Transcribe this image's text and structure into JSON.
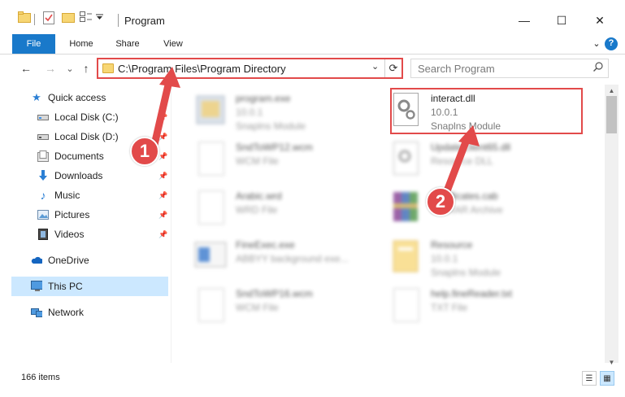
{
  "window": {
    "title": "Program",
    "minimize_glyph": "—",
    "maximize_glyph": "☐",
    "close_glyph": "✕"
  },
  "ribbon": {
    "tabs": [
      {
        "label": "File"
      },
      {
        "label": "Home"
      },
      {
        "label": "Share"
      },
      {
        "label": "View"
      }
    ],
    "help_glyph": "?"
  },
  "nav": {
    "back_glyph": "←",
    "forward_glyph": "→",
    "recent_glyph": "⌄",
    "up_glyph": "↑",
    "address": "C:\\Program Files\\Program Directory",
    "search_placeholder": "Search Program"
  },
  "sidebar": {
    "items": [
      {
        "label": "Quick access",
        "icon": "star-icon",
        "pinned": false
      },
      {
        "label": "Local Disk (C:)",
        "icon": "drive-icon",
        "pinned": true
      },
      {
        "label": "Local Disk (D:)",
        "icon": "drive-icon",
        "pinned": true
      },
      {
        "label": "Documents",
        "icon": "documents-icon",
        "pinned": true
      },
      {
        "label": "Downloads",
        "icon": "download-icon",
        "pinned": true
      },
      {
        "label": "Music",
        "icon": "music-icon",
        "pinned": true
      },
      {
        "label": "Pictures",
        "icon": "pictures-icon",
        "pinned": true
      },
      {
        "label": "Videos",
        "icon": "videos-icon",
        "pinned": true
      },
      {
        "label": "OneDrive",
        "icon": "cloud-icon",
        "pinned": false
      },
      {
        "label": "This PC",
        "icon": "computer-icon",
        "pinned": false,
        "selected": true
      },
      {
        "label": "Network",
        "icon": "network-icon",
        "pinned": false
      }
    ]
  },
  "files": [
    {
      "name": "program.exe",
      "line2": "10.0.1",
      "line3": "Snaplns Module",
      "blurred": true
    },
    {
      "name": "interact.dll",
      "line2": "10.0.1",
      "line3": "Snaplns Module",
      "blurred": false,
      "highlighted": true
    },
    {
      "name": "SndToWP12.wcm",
      "line2": "WCM File",
      "line3": "",
      "blurred": true
    },
    {
      "name": "UpdateClient65.dll",
      "line2": "Resource DLL",
      "line3": "",
      "blurred": true
    },
    {
      "name": "Arabic.wrd",
      "line2": "WRD File",
      "line3": "",
      "blurred": true
    },
    {
      "name": "Certificates.cab",
      "line2": "WinRAR Archive",
      "line3": "",
      "blurred": true
    },
    {
      "name": "FineExec.exe",
      "line2": "ABBYY background exe...",
      "line3": "",
      "blurred": true
    },
    {
      "name": "Resource",
      "line2": "10.0.1",
      "line3": "Snaplns Module",
      "blurred": true
    },
    {
      "name": "SndToWP16.wcm",
      "line2": "WCM File",
      "line3": "",
      "blurred": true
    },
    {
      "name": "help.fineReader.txt",
      "line2": "TXT File",
      "line3": "",
      "blurred": true
    }
  ],
  "status": {
    "item_count": "166 items"
  },
  "annotations": {
    "badge1": "1",
    "badge2": "2",
    "color": "#e24a4a"
  }
}
